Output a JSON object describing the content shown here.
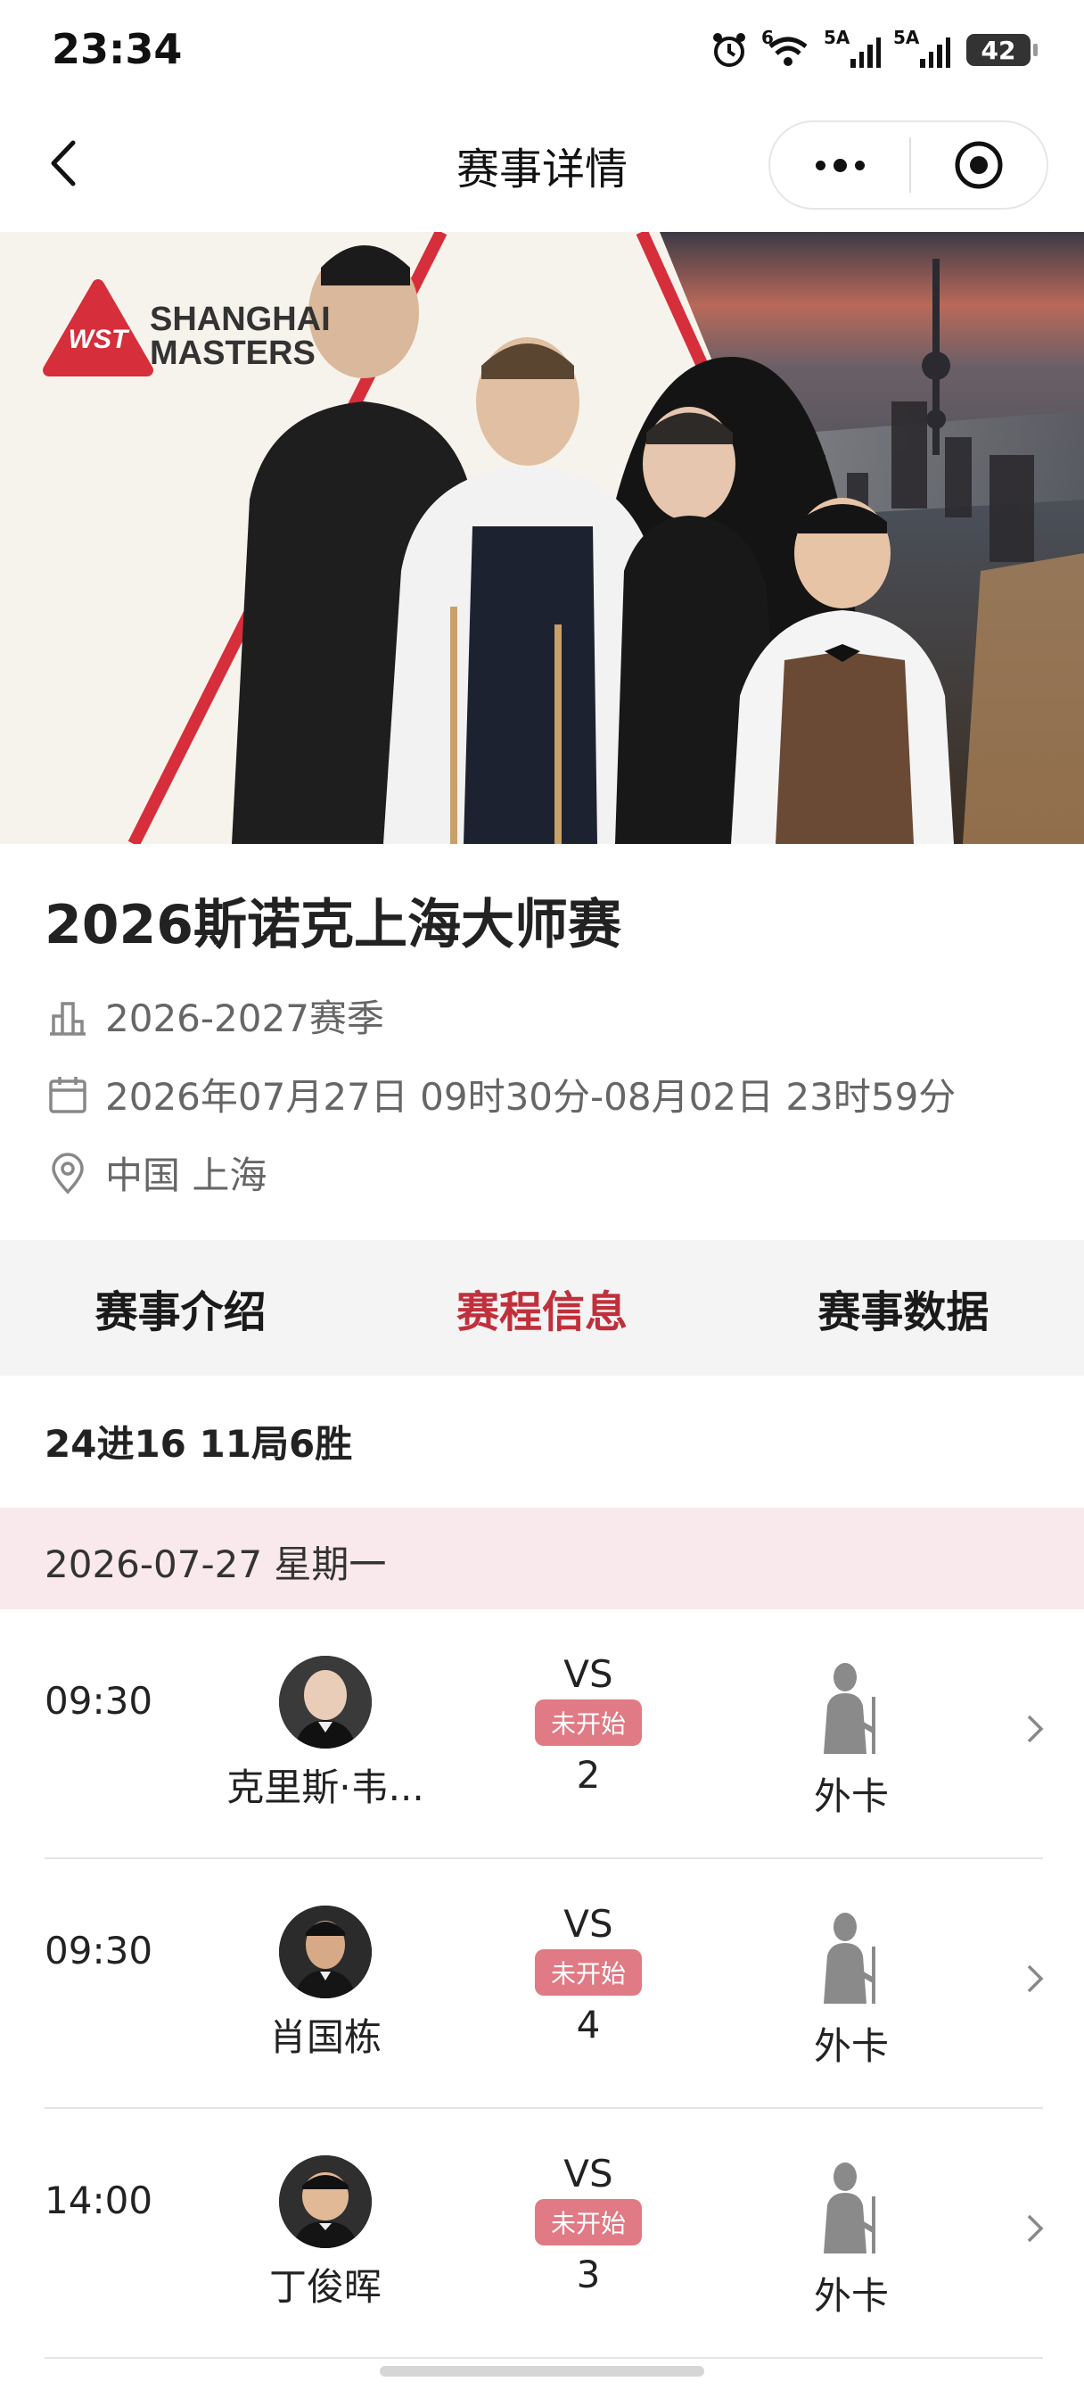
{
  "status_bar": {
    "time": "23:34",
    "signal_labels": [
      "5A",
      "5A"
    ],
    "wifi_label": "6",
    "battery": "42"
  },
  "nav": {
    "title": "赛事详情"
  },
  "banner": {
    "logo_badge": "WST",
    "logo_line1": "SHANGHAI",
    "logo_line2": "MASTERS"
  },
  "event": {
    "title": "2026斯诺克上海大师赛",
    "season": "2026-2027赛季",
    "datetime": "2026年07月27日 09时30分-08月02日 23时59分",
    "location": "中国 上海"
  },
  "tabs": [
    {
      "label": "赛事介绍",
      "active": false
    },
    {
      "label": "赛程信息",
      "active": true
    },
    {
      "label": "赛事数据",
      "active": false
    }
  ],
  "schedule": {
    "round_title": "24进16 11局6胜",
    "date_label": "2026-07-27 星期一",
    "matches": [
      {
        "time": "09:30",
        "player1": "克里斯·韦...",
        "vs": "VS",
        "status": "未开始",
        "table": "2",
        "player2": "外卡"
      },
      {
        "time": "09:30",
        "player1": "肖国栋",
        "vs": "VS",
        "status": "未开始",
        "table": "4",
        "player2": "外卡"
      },
      {
        "time": "14:00",
        "player1": "丁俊晖",
        "vs": "VS",
        "status": "未开始",
        "table": "3",
        "player2": "外卡"
      }
    ]
  },
  "colors": {
    "accent": "#c0303c",
    "badge": "#e07a84",
    "date_bar": "#f9e9ec",
    "tab_bg": "#f4f4f4"
  }
}
